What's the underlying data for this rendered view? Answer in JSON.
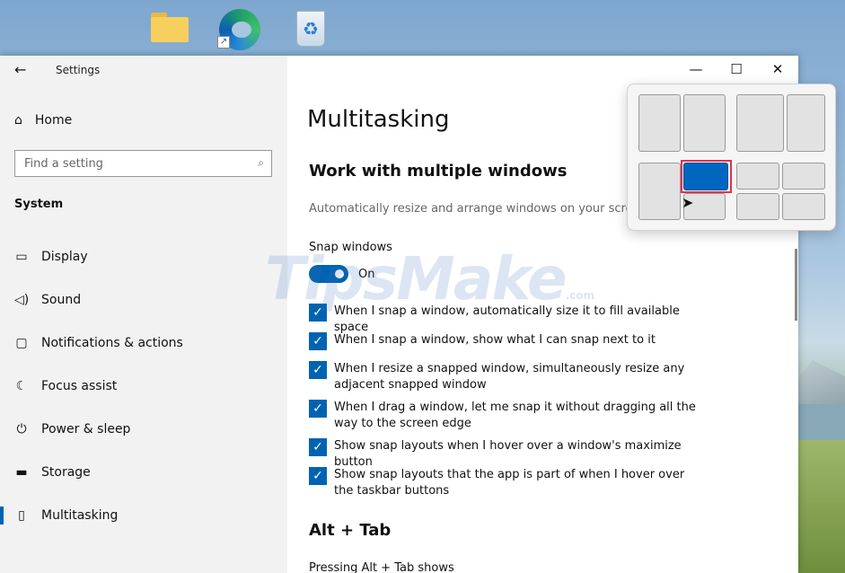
{
  "window": {
    "app_title": "Settings",
    "back_glyph": "←",
    "minimize_glyph": "—",
    "maximize_glyph": "☐",
    "close_glyph": "✕"
  },
  "sidebar": {
    "home_label": "Home",
    "home_icon": "⌂",
    "search_placeholder": "Find a setting",
    "search_icon": "⌕",
    "section": "System",
    "items": [
      {
        "label": "Display",
        "icon": "▭"
      },
      {
        "label": "Sound",
        "icon": "◁)"
      },
      {
        "label": "Notifications & actions",
        "icon": "▢"
      },
      {
        "label": "Focus assist",
        "icon": "☾"
      },
      {
        "label": "Power & sleep",
        "icon": "⏻"
      },
      {
        "label": "Storage",
        "icon": "▬"
      },
      {
        "label": "Multitasking",
        "icon": "▯"
      }
    ]
  },
  "main": {
    "page_title": "Multitasking",
    "sub_heading": "Work with multiple windows",
    "description": "Automatically resize and arrange windows on your screen",
    "snap_label": "Snap windows",
    "toggle_state": "On",
    "checkboxes": [
      {
        "label": "When I snap a window, automatically size it to fill available space",
        "checked": true
      },
      {
        "label": "When I snap a window, show what I can snap next to it",
        "checked": true
      },
      {
        "label": "When I resize a snapped window, simultaneously resize any adjacent snapped window",
        "checked": true
      },
      {
        "label": "When I drag a window, let me snap it without dragging all the way to the screen edge",
        "checked": true
      },
      {
        "label": "Show snap layouts when I hover over a window's maximize button",
        "checked": true
      },
      {
        "label": "Show snap layouts that the app is part of when I hover over the taskbar buttons",
        "checked": true
      }
    ],
    "check_glyph": "✓",
    "alt_tab_heading": "Alt + Tab",
    "alt_tab_sub": "Pressing Alt + Tab shows"
  },
  "watermark": {
    "text": "TipsMake",
    "small": ".com"
  },
  "colors": {
    "accent": "#0063b1",
    "selection_border": "#e0334a"
  }
}
